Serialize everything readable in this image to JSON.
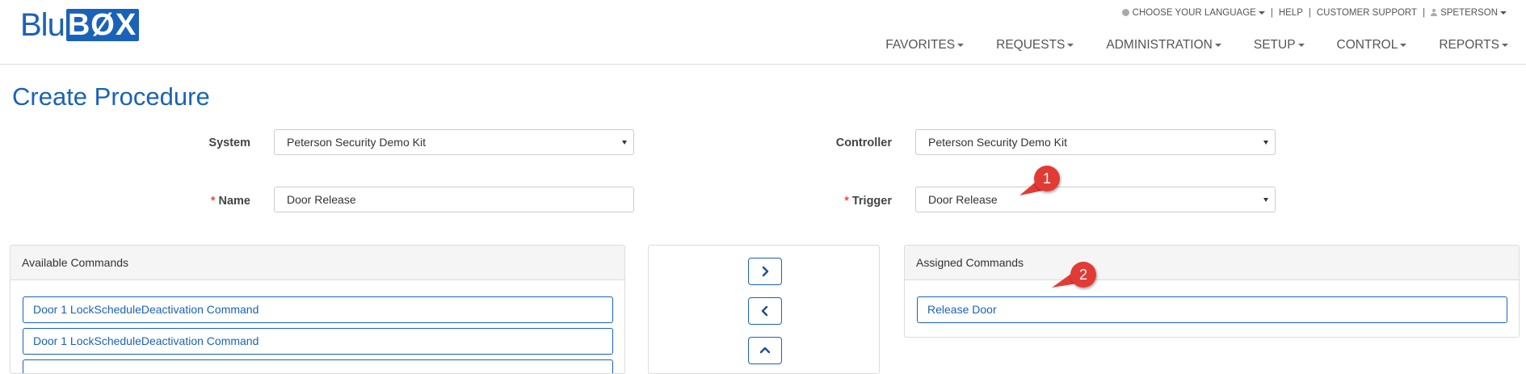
{
  "header": {
    "logo_left": "Blu",
    "logo_right": "BØX",
    "utility": {
      "language": "CHOOSE YOUR LANGUAGE",
      "help": "HELP",
      "support": "CUSTOMER SUPPORT",
      "user": "SPETERSON"
    },
    "nav": [
      {
        "label": "FAVORITES"
      },
      {
        "label": "REQUESTS"
      },
      {
        "label": "ADMINISTRATION"
      },
      {
        "label": "SETUP"
      },
      {
        "label": "CONTROL"
      },
      {
        "label": "REPORTS"
      }
    ]
  },
  "page": {
    "title": "Create Procedure"
  },
  "form": {
    "required_marker": "*",
    "system": {
      "label": "System",
      "value": "Peterson Security Demo Kit"
    },
    "controller": {
      "label": "Controller",
      "value": "Peterson Security Demo Kit"
    },
    "name": {
      "label": "Name",
      "value": "Door Release"
    },
    "trigger": {
      "label": "Trigger",
      "value": "Door Release"
    }
  },
  "available": {
    "heading": "Available Commands",
    "items": [
      {
        "label": "Door 1 LockScheduleDeactivation Command"
      },
      {
        "label": "Door 1 LockScheduleDeactivation Command"
      },
      {
        "label": ""
      }
    ]
  },
  "assigned": {
    "heading": "Assigned Commands",
    "items": [
      {
        "label": "Release Door"
      }
    ]
  },
  "controls": {
    "move_right_icon": "chevron-right-icon",
    "move_left_icon": "chevron-left-icon",
    "move_up_icon": "chevron-up-icon"
  },
  "callouts": [
    {
      "number": "1",
      "color": "#e23b36"
    },
    {
      "number": "2",
      "color": "#e23b36"
    }
  ],
  "colors": {
    "brand": "#1a62b8",
    "required": "#d9534f",
    "callout": "#e23b36"
  }
}
